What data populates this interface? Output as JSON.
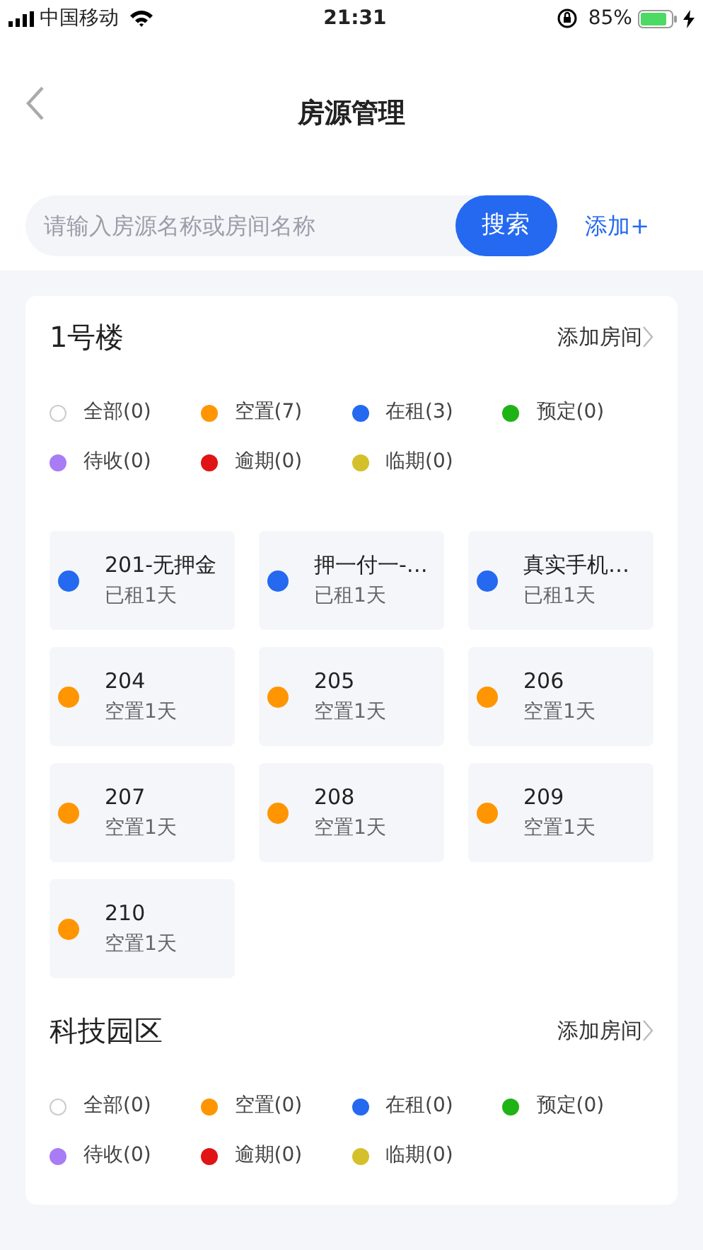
{
  "status_bar": {
    "carrier": "中国移动",
    "time": "21:31",
    "battery": "85%"
  },
  "header": {
    "title": "房源管理"
  },
  "search": {
    "placeholder": "请输入房源名称或房间名称",
    "button": "搜索",
    "add": "添加+"
  },
  "buildings": [
    {
      "name": "1号楼",
      "add_room": "添加房间",
      "legend": [
        {
          "label": "全部(0)",
          "kind": "outline",
          "color": "#cccccc"
        },
        {
          "label": "空置(7)",
          "kind": "dot",
          "color": "#ff9500"
        },
        {
          "label": "在租(3)",
          "kind": "dot",
          "color": "#2469f0"
        },
        {
          "label": "预定(0)",
          "kind": "dot",
          "color": "#1fb316"
        },
        {
          "label": "待收(0)",
          "kind": "dot",
          "color": "#a87cf5"
        },
        {
          "label": "逾期(0)",
          "kind": "dot",
          "color": "#e01414"
        },
        {
          "label": "临期(0)",
          "kind": "dot",
          "color": "#d4c02a"
        }
      ],
      "rooms": [
        {
          "name": "201-无押金",
          "status": "已租1天",
          "color": "#2469f0"
        },
        {
          "name": "押一付一-…",
          "status": "已租1天",
          "color": "#2469f0"
        },
        {
          "name": "真实手机…",
          "status": "已租1天",
          "color": "#2469f0"
        },
        {
          "name": "204",
          "status": "空置1天",
          "color": "#ff9500"
        },
        {
          "name": "205",
          "status": "空置1天",
          "color": "#ff9500"
        },
        {
          "name": "206",
          "status": "空置1天",
          "color": "#ff9500"
        },
        {
          "name": "207",
          "status": "空置1天",
          "color": "#ff9500"
        },
        {
          "name": "208",
          "status": "空置1天",
          "color": "#ff9500"
        },
        {
          "name": "209",
          "status": "空置1天",
          "color": "#ff9500"
        },
        {
          "name": "210",
          "status": "空置1天",
          "color": "#ff9500"
        }
      ]
    },
    {
      "name": "科技园区",
      "add_room": "添加房间",
      "legend": [
        {
          "label": "全部(0)",
          "kind": "outline",
          "color": "#cccccc"
        },
        {
          "label": "空置(0)",
          "kind": "dot",
          "color": "#ff9500"
        },
        {
          "label": "在租(0)",
          "kind": "dot",
          "color": "#2469f0"
        },
        {
          "label": "预定(0)",
          "kind": "dot",
          "color": "#1fb316"
        },
        {
          "label": "待收(0)",
          "kind": "dot",
          "color": "#a87cf5"
        },
        {
          "label": "逾期(0)",
          "kind": "dot",
          "color": "#e01414"
        },
        {
          "label": "临期(0)",
          "kind": "dot",
          "color": "#d4c02a"
        }
      ]
    }
  ]
}
